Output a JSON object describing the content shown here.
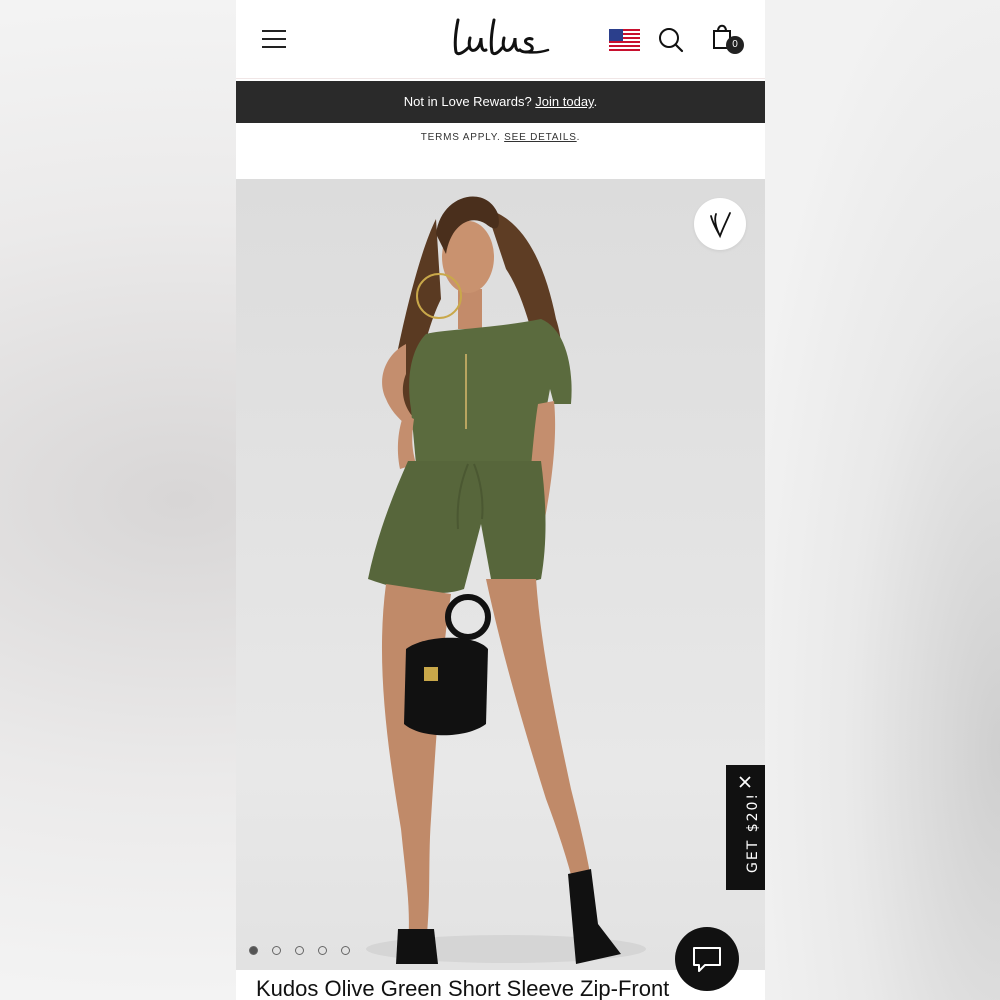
{
  "header": {
    "logo_text": "Lulus",
    "bag_count": "0"
  },
  "rewards": {
    "prefix": "Not in Love Rewards? ",
    "link": "Join today",
    "suffix": "."
  },
  "terms": {
    "prefix": "TERMS APPLY. ",
    "link": "SEE DETAILS",
    "suffix": "."
  },
  "gallery": {
    "dot_count": 5,
    "active_index": 0
  },
  "promo": {
    "label": "GET $20!"
  },
  "product": {
    "title": "Kudos Olive Green Short Sleeve Zip-Front"
  },
  "colors": {
    "dark_bar": "#2a2a2a",
    "olive": "#5b6b3e"
  }
}
